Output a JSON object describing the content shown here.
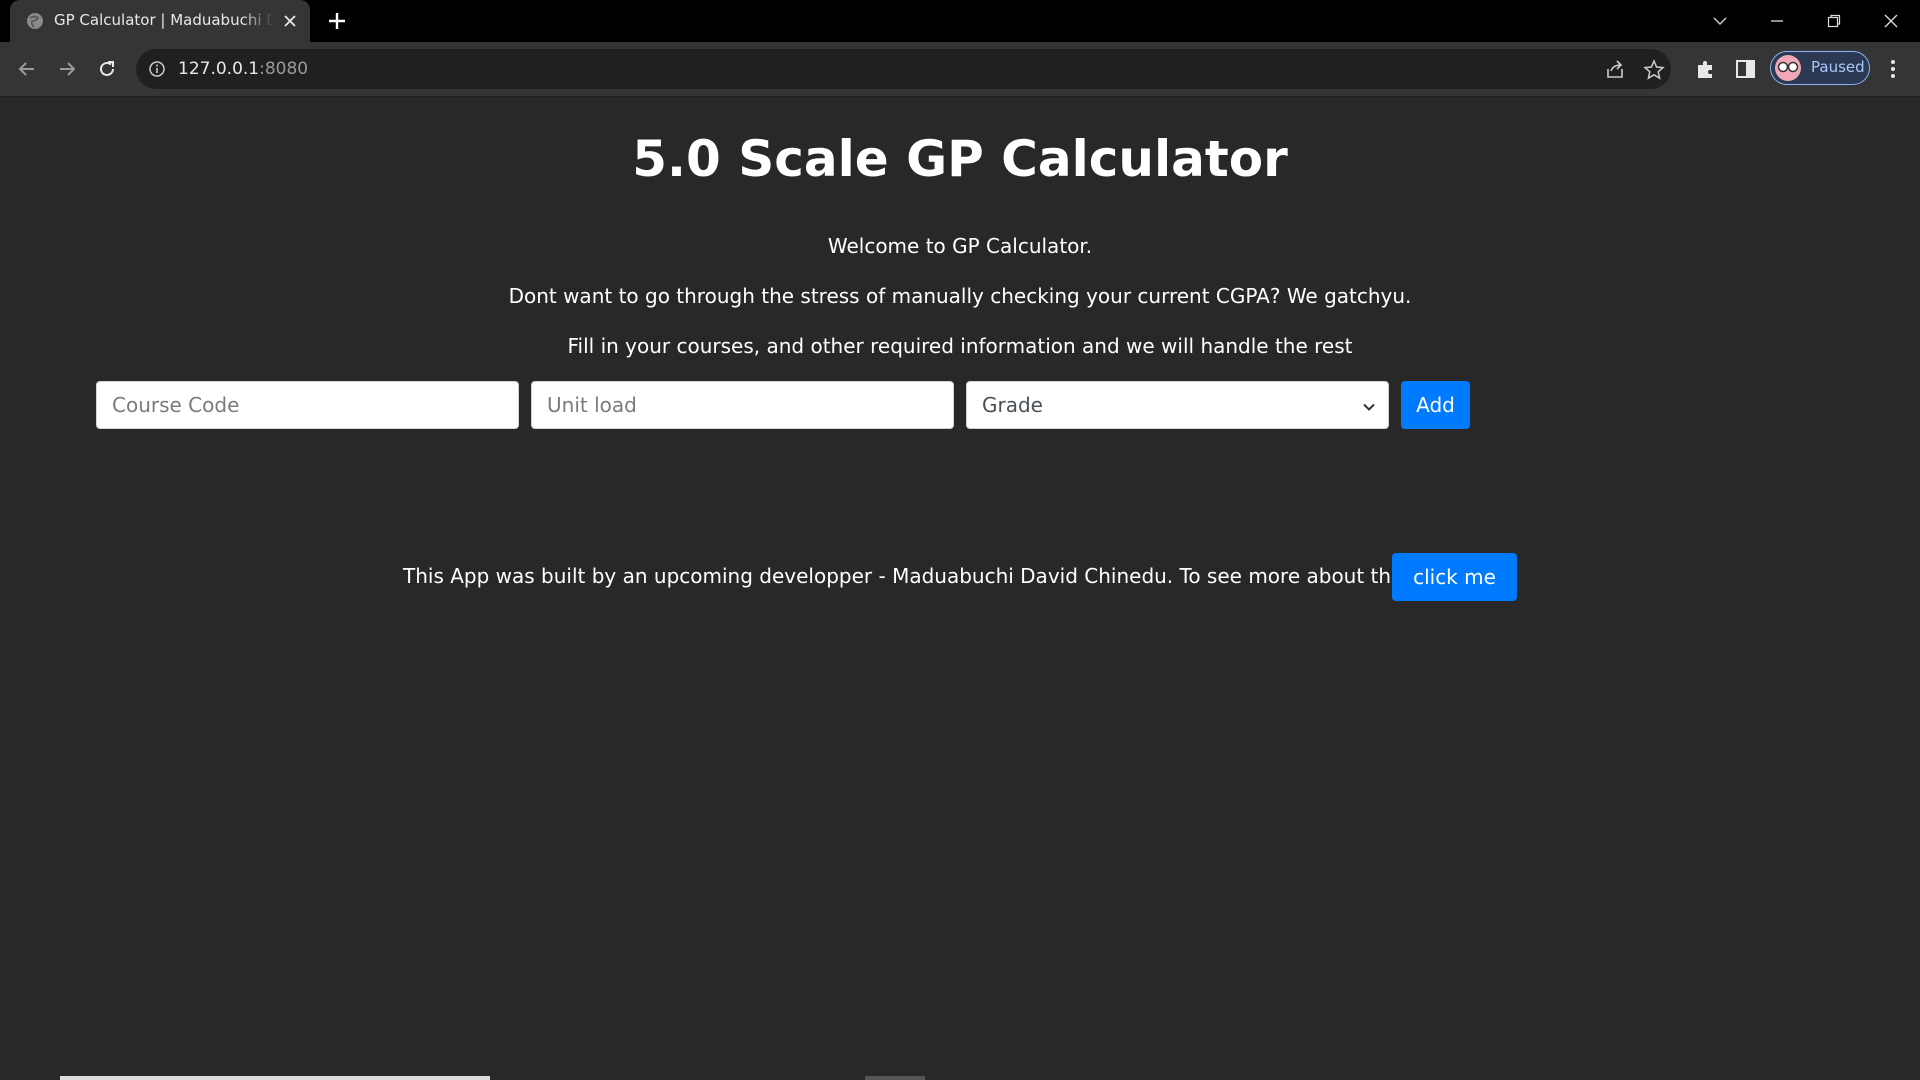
{
  "browser": {
    "tab_title": "GP Calculator | Maduabuchi David Chinedu",
    "url_host": "127.0.0.1",
    "url_port": ":8080",
    "profile_label": "Paused",
    "accent": "#8ab4f8"
  },
  "page": {
    "title": "5.0 Scale GP Calculator",
    "intro": [
      "Welcome to GP Calculator.",
      "Dont want to go through the stress of manually checking your current CGPA? We gatchyu.",
      "Fill in your courses, and other required information and we will handle the rest"
    ],
    "form": {
      "course_code_placeholder": "Course Code",
      "unit_load_placeholder": "Unit load",
      "grade_selected": "Grade",
      "add_label": "Add"
    },
    "footer": {
      "text": "This App was built by an upcoming developper - Maduabuchi David Chinedu. To see more about the developer,",
      "button_label": "click me"
    },
    "primary_color": "#007bff",
    "background_color": "#282828"
  }
}
